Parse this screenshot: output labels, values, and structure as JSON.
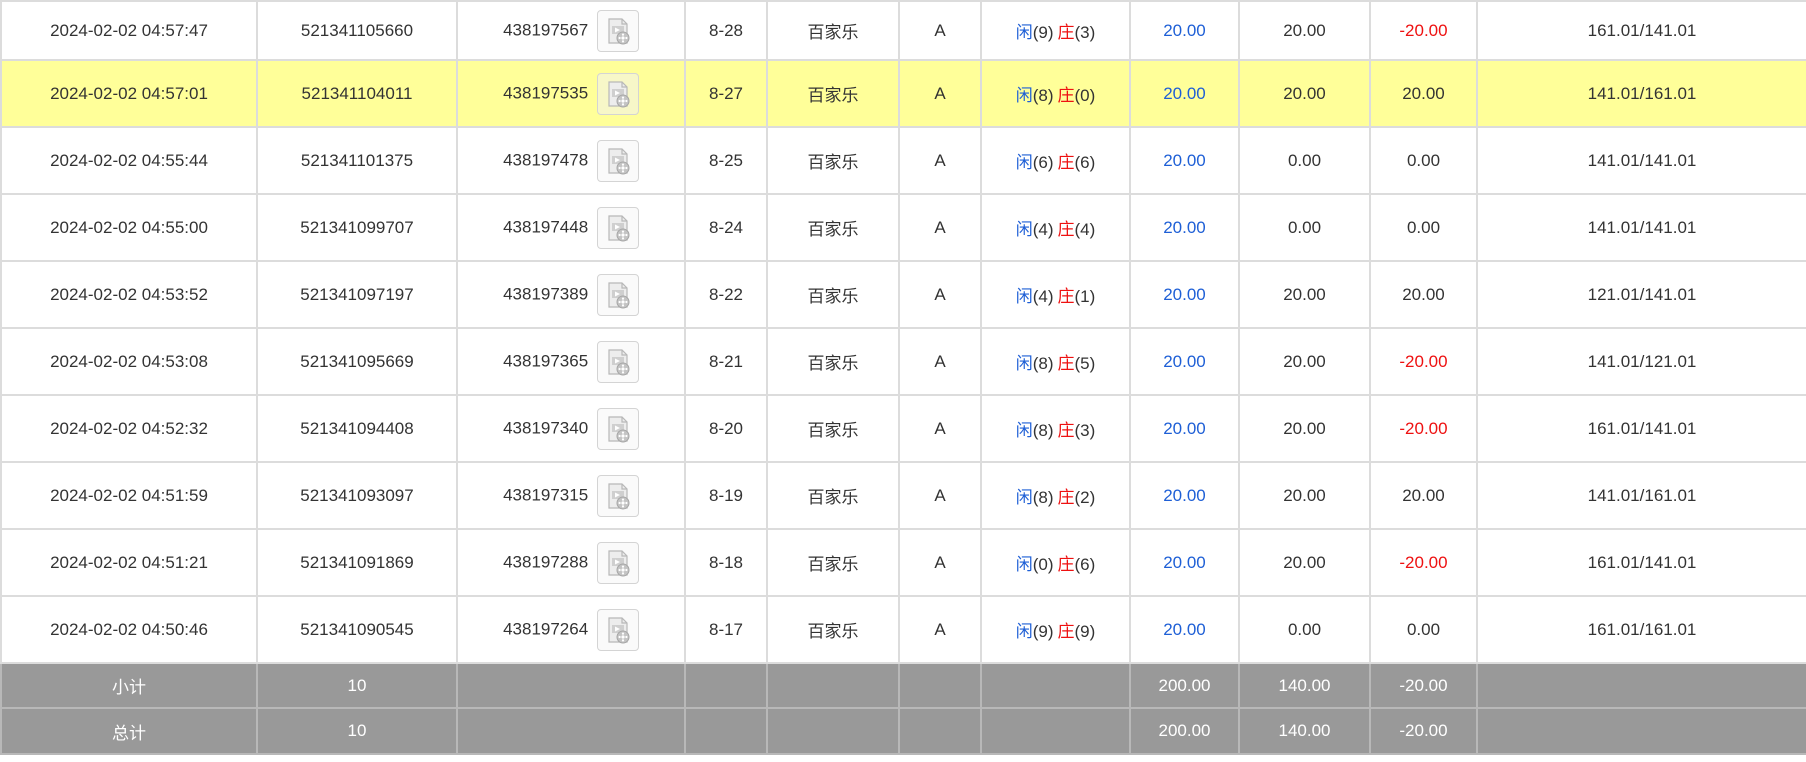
{
  "rows": [
    {
      "time": "2024-02-02 04:57:47",
      "bet_id": "521341105660",
      "round_id": "438197567",
      "shoe": "8-28",
      "game": "百家乐",
      "table": "A",
      "player_label": "闲",
      "player_score": "(9)",
      "banker_label": "庄",
      "banker_score": "(3)",
      "bet": "20.00",
      "valid": "20.00",
      "win": "-20.00",
      "balance": "161.01/141.01"
    },
    {
      "time": "2024-02-02 04:57:01",
      "bet_id": "521341104011",
      "round_id": "438197535",
      "shoe": "8-27",
      "game": "百家乐",
      "table": "A",
      "player_label": "闲",
      "player_score": "(8)",
      "banker_label": "庄",
      "banker_score": "(0)",
      "bet": "20.00",
      "valid": "20.00",
      "win": "20.00",
      "balance": "141.01/161.01"
    },
    {
      "time": "2024-02-02 04:55:44",
      "bet_id": "521341101375",
      "round_id": "438197478",
      "shoe": "8-25",
      "game": "百家乐",
      "table": "A",
      "player_label": "闲",
      "player_score": "(6)",
      "banker_label": "庄",
      "banker_score": "(6)",
      "bet": "20.00",
      "valid": "0.00",
      "win": "0.00",
      "balance": "141.01/141.01"
    },
    {
      "time": "2024-02-02 04:55:00",
      "bet_id": "521341099707",
      "round_id": "438197448",
      "shoe": "8-24",
      "game": "百家乐",
      "table": "A",
      "player_label": "闲",
      "player_score": "(4)",
      "banker_label": "庄",
      "banker_score": "(4)",
      "bet": "20.00",
      "valid": "0.00",
      "win": "0.00",
      "balance": "141.01/141.01"
    },
    {
      "time": "2024-02-02 04:53:52",
      "bet_id": "521341097197",
      "round_id": "438197389",
      "shoe": "8-22",
      "game": "百家乐",
      "table": "A",
      "player_label": "闲",
      "player_score": "(4)",
      "banker_label": "庄",
      "banker_score": "(1)",
      "bet": "20.00",
      "valid": "20.00",
      "win": "20.00",
      "balance": "121.01/141.01"
    },
    {
      "time": "2024-02-02 04:53:08",
      "bet_id": "521341095669",
      "round_id": "438197365",
      "shoe": "8-21",
      "game": "百家乐",
      "table": "A",
      "player_label": "闲",
      "player_score": "(8)",
      "banker_label": "庄",
      "banker_score": "(5)",
      "bet": "20.00",
      "valid": "20.00",
      "win": "-20.00",
      "balance": "141.01/121.01"
    },
    {
      "time": "2024-02-02 04:52:32",
      "bet_id": "521341094408",
      "round_id": "438197340",
      "shoe": "8-20",
      "game": "百家乐",
      "table": "A",
      "player_label": "闲",
      "player_score": "(8)",
      "banker_label": "庄",
      "banker_score": "(3)",
      "bet": "20.00",
      "valid": "20.00",
      "win": "-20.00",
      "balance": "161.01/141.01"
    },
    {
      "time": "2024-02-02 04:51:59",
      "bet_id": "521341093097",
      "round_id": "438197315",
      "shoe": "8-19",
      "game": "百家乐",
      "table": "A",
      "player_label": "闲",
      "player_score": "(8)",
      "banker_label": "庄",
      "banker_score": "(2)",
      "bet": "20.00",
      "valid": "20.00",
      "win": "20.00",
      "balance": "141.01/161.01"
    },
    {
      "time": "2024-02-02 04:51:21",
      "bet_id": "521341091869",
      "round_id": "438197288",
      "shoe": "8-18",
      "game": "百家乐",
      "table": "A",
      "player_label": "闲",
      "player_score": "(0)",
      "banker_label": "庄",
      "banker_score": "(6)",
      "bet": "20.00",
      "valid": "20.00",
      "win": "-20.00",
      "balance": "161.01/141.01"
    },
    {
      "time": "2024-02-02 04:50:46",
      "bet_id": "521341090545",
      "round_id": "438197264",
      "shoe": "8-17",
      "game": "百家乐",
      "table": "A",
      "player_label": "闲",
      "player_score": "(9)",
      "banker_label": "庄",
      "banker_score": "(9)",
      "bet": "20.00",
      "valid": "0.00",
      "win": "0.00",
      "balance": "161.01/161.01"
    }
  ],
  "subtotal": {
    "label": "小计",
    "count": "10",
    "bet": "200.00",
    "valid": "140.00",
    "win": "-20.00"
  },
  "total": {
    "label": "总计",
    "count": "10",
    "bet": "200.00",
    "valid": "140.00",
    "win": "-20.00"
  },
  "highlight_row": 1,
  "icons": {
    "replay": "video-replay-icon"
  },
  "colors": {
    "highlight": "#ffff99",
    "player": "#1e5fd6",
    "banker": "#ee1111",
    "negative": "#ee1111",
    "summary_bg": "#999999"
  }
}
